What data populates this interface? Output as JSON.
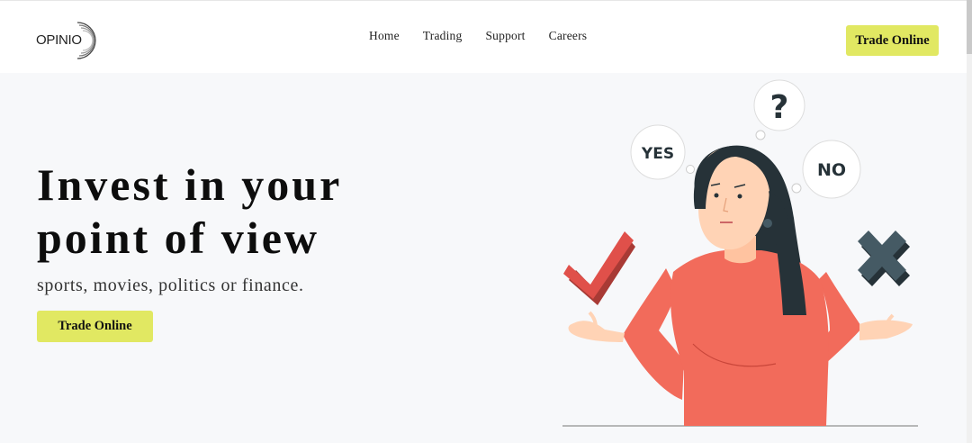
{
  "header": {
    "logo_text": "OPINIO",
    "nav": [
      "Home",
      "Trading",
      "Support",
      "Careers"
    ],
    "cta_label": "Trade Online"
  },
  "hero": {
    "title": "Invest in your point of view",
    "subtitle": "sports, movies, politics or finance.",
    "cta_label": "Trade Online"
  },
  "illustration": {
    "bubble_question": "?",
    "bubble_yes": "YES",
    "bubble_no": "NO"
  },
  "colors": {
    "accent": "#e1e862",
    "shirt": "#f26b5b",
    "hair": "#263238",
    "check": "#e0504a",
    "cross": "#37474f",
    "background": "#f7f8fa"
  }
}
